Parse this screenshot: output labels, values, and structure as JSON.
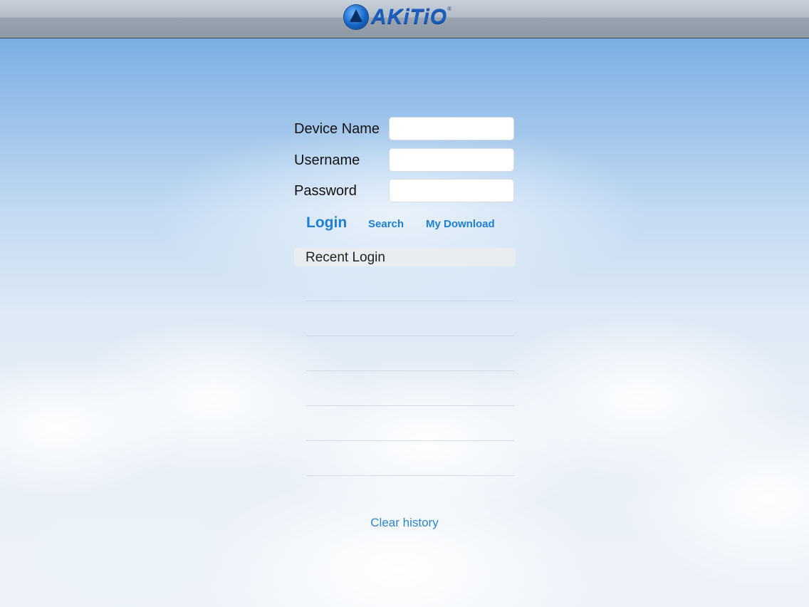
{
  "header": {
    "logo_text": "AKiTiO",
    "logo_mark": "®"
  },
  "form": {
    "device_name": {
      "label": "Device Name",
      "value": "",
      "placeholder": ""
    },
    "username": {
      "label": "Username",
      "value": "",
      "placeholder": ""
    },
    "password": {
      "label": "Password",
      "value": "",
      "placeholder": ""
    }
  },
  "actions": {
    "login": "Login",
    "search": "Search",
    "my_download": "My Download"
  },
  "recent": {
    "title": "Recent Login",
    "rows": [
      "",
      "",
      "",
      "",
      "",
      ""
    ]
  },
  "footer": {
    "clear_history": "Clear history"
  },
  "colors": {
    "accent": "#1a7fd6",
    "link": "#2b86cf"
  }
}
